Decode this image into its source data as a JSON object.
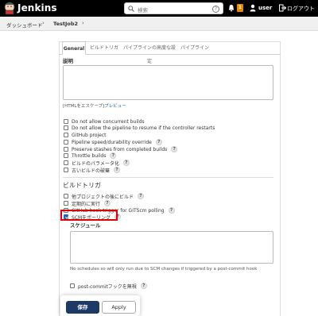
{
  "header": {
    "brand": "Jenkins",
    "search_placeholder": "検索",
    "help_glyph": "?",
    "notification_count": "1",
    "user": "user",
    "logout": "ログアウト",
    "accent": "#e58a00",
    "icons": [
      "jenkins-logo-icon",
      "search-icon",
      "help-icon",
      "bell-icon",
      "user-icon",
      "logout-icon"
    ]
  },
  "breadcrumb": {
    "items": [
      "ダッシュボード",
      "TestJob2"
    ],
    "separator": "›"
  },
  "tabs": [
    "General",
    "ビルドトリガ",
    "パイプラインの高度な設定",
    "パイプライン"
  ],
  "general": {
    "description_label": "説明",
    "description_value": "",
    "html_note": "[HTMLをエスケープ]",
    "preview_link": "プレビュー",
    "options": [
      {
        "label": "Do not allow concurrent builds",
        "checked": false,
        "help": false
      },
      {
        "label": "Do not allow the pipeline to resume if the controller restarts",
        "checked": false,
        "help": false
      },
      {
        "label": "GitHub project",
        "checked": false,
        "help": false
      },
      {
        "label": "Pipeline speed/durability override",
        "checked": false,
        "help": true
      },
      {
        "label": "Preserve stashes from completed builds",
        "checked": false,
        "help": true
      },
      {
        "label": "Throttle builds",
        "checked": false,
        "help": true
      },
      {
        "label": "ビルドのパラメータ化",
        "checked": false,
        "help": true
      },
      {
        "label": "古いビルドの破棄",
        "checked": false,
        "help": true
      }
    ]
  },
  "build_triggers": {
    "title": "ビルドトリガ",
    "options": [
      {
        "label": "他プロジェクトの後にビルド",
        "checked": false,
        "help": true
      },
      {
        "label": "定期的に実行",
        "checked": false,
        "help": true
      },
      {
        "label": "GitHub hook trigger for GITScm polling",
        "checked": false,
        "help": true
      },
      {
        "label": "SCMをポーリング",
        "checked": true,
        "help": true
      }
    ],
    "schedule_label": "スケジュール",
    "schedule_value": "",
    "schedule_note": "No schedules so will only run due to SCM changes if triggered by a post-commit hook",
    "post_commit_label": "post-commitフックを無視",
    "highlight_color": "#e00000"
  },
  "buttons": {
    "save": "保存",
    "apply": "Apply",
    "save_color": "#1d3a66"
  }
}
